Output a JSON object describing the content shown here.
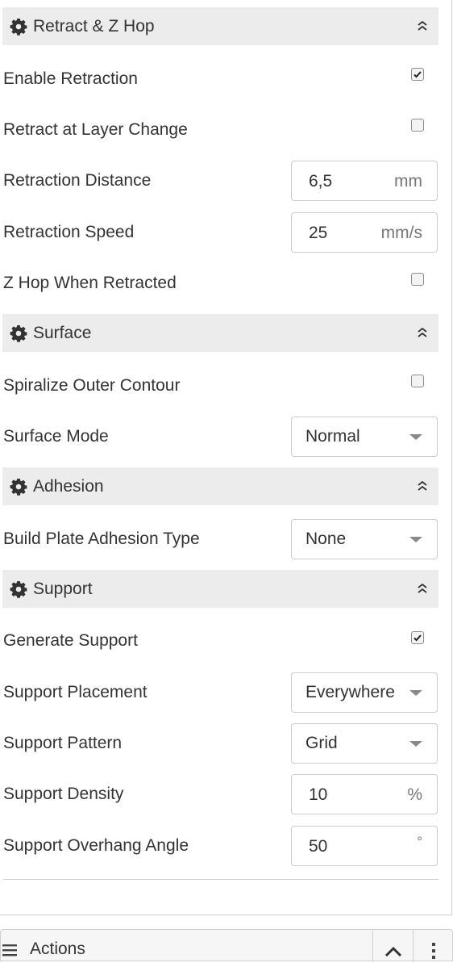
{
  "sections": {
    "retract": {
      "title": "Retract & Z Hop"
    },
    "surface": {
      "title": "Surface"
    },
    "adhesion": {
      "title": "Adhesion"
    },
    "support": {
      "title": "Support"
    }
  },
  "settings": {
    "enable_retraction": {
      "label": "Enable Retraction",
      "checked": true
    },
    "retract_layer_change": {
      "label": "Retract at Layer Change",
      "checked": false
    },
    "retraction_distance": {
      "label": "Retraction Distance",
      "value": "6,5",
      "unit": "mm"
    },
    "retraction_speed": {
      "label": "Retraction Speed",
      "value": "25",
      "unit": "mm/s"
    },
    "z_hop": {
      "label": "Z Hop When Retracted",
      "checked": false
    },
    "spiralize": {
      "label": "Spiralize Outer Contour",
      "checked": false
    },
    "surface_mode": {
      "label": "Surface Mode",
      "value": "Normal"
    },
    "adhesion_type": {
      "label": "Build Plate Adhesion Type",
      "value": "None"
    },
    "generate_support": {
      "label": "Generate Support",
      "checked": true
    },
    "support_placement": {
      "label": "Support Placement",
      "value": "Everywhere"
    },
    "support_pattern": {
      "label": "Support Pattern",
      "value": "Grid"
    },
    "support_density": {
      "label": "Support Density",
      "value": "10",
      "unit": "%"
    },
    "support_overhang": {
      "label": "Support Overhang Angle",
      "value": "50",
      "unit": "°"
    }
  },
  "actions": {
    "title": "Actions"
  },
  "icons": {
    "section": "gear-icon",
    "collapse": "chevron-double-up-icon",
    "checkbox": "check-icon",
    "select": "caret-down-icon",
    "actions": "hamburger-menu-icon",
    "more": "vertical-dots-icon"
  }
}
